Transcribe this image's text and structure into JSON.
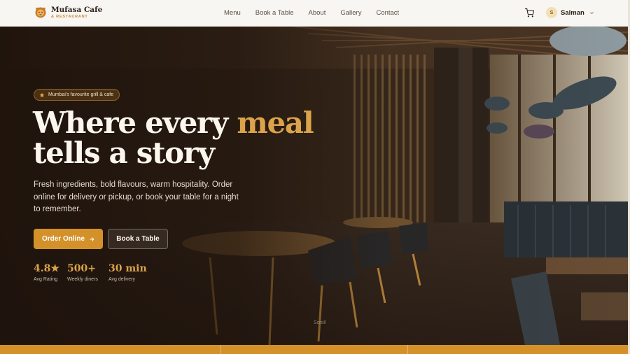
{
  "brand": {
    "name": "Mufasa Cafe",
    "sub": "& RESTAURANT",
    "accent": "#d4912a"
  },
  "nav": [
    "Menu",
    "Book a Table",
    "About",
    "Gallery",
    "Contact"
  ],
  "header": {
    "cart_icon": "cart-icon",
    "user_initial": "S",
    "user_name": "Salman"
  },
  "hero": {
    "badge": "Mumbai's favourite grill & cafe",
    "headline_1": "Where every ",
    "headline_accent": "meal",
    "headline_2": "tells a story",
    "subtext": "Fresh ingredients, bold flavours, warm hospitality. Order online for delivery or pickup, or book your table for a night to remember.",
    "primary_cta": "Order Online",
    "secondary_cta": "Book a Table",
    "stats": [
      {
        "value": "4.8★",
        "label": "Avg Rating"
      },
      {
        "value": "500+",
        "label": "Weekly diners"
      },
      {
        "value": "30 min",
        "label": "Avg delivery"
      }
    ],
    "scroll_label": "Scroll"
  }
}
